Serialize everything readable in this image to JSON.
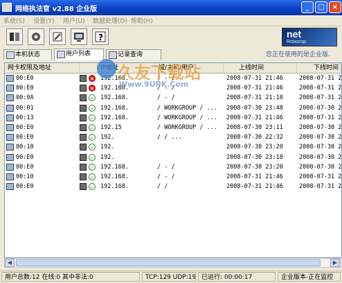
{
  "window": {
    "title": "网络执法官 v2.88 企业版",
    "min_label": "_",
    "max_label": "□",
    "close_label": "×"
  },
  "menu": [
    "系统(S)",
    "设置(Y)",
    "用户(U)",
    "数据处理(D)",
    "帮助(H)"
  ],
  "toolbar": {
    "buttons": [
      "tool-1",
      "tool-2",
      "tool-3",
      "tool-4",
      "help"
    ]
  },
  "brand": {
    "name": "net",
    "sub": "Robocop"
  },
  "tabs": [
    "本机状态",
    "用户列表",
    "记录查询"
  ],
  "active_tab": 1,
  "edition_note": "您正在使用的是企业版.",
  "table": {
    "headers": [
      "网卡权限及地址",
      "",
      "IP地址",
      "域/主机/用户",
      "上线时间",
      "下线时间"
    ],
    "rows": [
      {
        "mac": "00:E0",
        "status": "bad",
        "ip": "192.168.",
        "host": "/ - /",
        "online": "2008-07-31 21:46",
        "offline": "2008-07-31 21"
      },
      {
        "mac": "00:E0",
        "status": "bad",
        "ip": "192.168.",
        "host": "/ - /",
        "online": "2008-07-31 21:46",
        "offline": "2008-07-31 21"
      },
      {
        "mac": "00:0A",
        "status": "ok",
        "ip": "192.168.",
        "host": "/ - /",
        "online": "2008-07-31 21:10",
        "offline": "2008-07-31 21"
      },
      {
        "mac": "00:01",
        "status": "ok",
        "ip": "192.168.",
        "host": "/ WORKGROUP / ...",
        "online": "2008-07-30 23:48",
        "offline": "2008-07-30 23"
      },
      {
        "mac": "00:13",
        "status": "ok",
        "ip": "192.168.",
        "host": "/ WORKGROUP / ...",
        "online": "2008-07-31 21:46",
        "offline": "2008-07-31 21"
      },
      {
        "mac": "00:E0",
        "status": "ok",
        "ip": "192.15",
        "host": "/ WORKGROUP / ...",
        "online": "2008-07-30 23:11",
        "offline": "2008-07-30 23"
      },
      {
        "mac": "00:E0",
        "status": "ok",
        "ip": "192.",
        "host": "/ / ...",
        "online": "2008-07-30 22:32",
        "offline": "2008-07-30 23"
      },
      {
        "mac": "00:10",
        "status": "ok",
        "ip": "192.",
        "host": "",
        "online": "2008-07-30 23:20",
        "offline": "2008-07-30 23"
      },
      {
        "mac": "00:E0",
        "status": "ok",
        "ip": "192.",
        "host": "",
        "online": "2008-07-30 23:18",
        "offline": "2008-07-30 23"
      },
      {
        "mac": "00:E0",
        "status": "ok",
        "ip": "192.168.",
        "host": "/ - /",
        "online": "2008-07-30 23:20",
        "offline": "2008-07-30 23"
      },
      {
        "mac": "00:10",
        "status": "ok",
        "ip": "192.168.",
        "host": "/ - /",
        "online": "2008-07-31 21:46",
        "offline": "2008-07-31 21"
      },
      {
        "mac": "00:E0",
        "status": "ok",
        "ip": "192.168.",
        "host": "/ /",
        "online": "2008-07-31 21:46",
        "offline": "2008-07-31 21"
      }
    ]
  },
  "watermark": {
    "title": "久友下载站",
    "url": "Www.9UPK.Com"
  },
  "statusbar": {
    "users": "用户总数:12 在线:0 其中非法:0",
    "traffic": "TCP:129 UDP:199",
    "uptime": "已运行: 00:00:17",
    "edition": "企业版本-正在监控"
  },
  "colors": {
    "title_bar": "#0a3fc2",
    "ok": "#1a8a2a",
    "bad": "#d22"
  }
}
